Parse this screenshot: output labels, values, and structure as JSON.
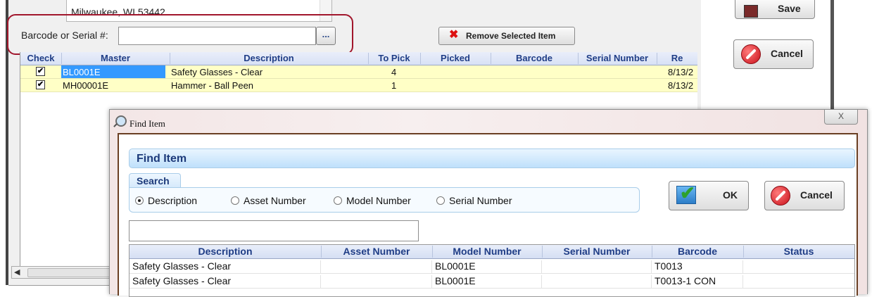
{
  "background": {
    "address_line": "Milwaukee, WI  53442",
    "barcode_label": "Barcode or Serial #:",
    "barcode_value": "",
    "browse_label": "...",
    "remove_button": "Remove Selected Item",
    "save_button": "Save",
    "cancel_button": "Cancel",
    "grid": {
      "columns": [
        "Check",
        "Master",
        "Description",
        "To Pick",
        "Picked",
        "Barcode",
        "Serial Number",
        "Re"
      ],
      "rows": [
        {
          "checked": true,
          "master": "BL0001E",
          "description": "Safety Glasses - Clear",
          "to_pick": "4",
          "picked": "",
          "barcode": "",
          "serial": "",
          "re": "8/13/2"
        },
        {
          "checked": true,
          "master": "MH00001E",
          "description": "Hammer - Ball Peen",
          "to_pick": "1",
          "picked": "",
          "barcode": "",
          "serial": "",
          "re": "8/13/2"
        }
      ]
    }
  },
  "dialog": {
    "title": "Find Item",
    "close_label": "X",
    "header": "Find Item",
    "search_tab": "Search",
    "search_options": [
      "Description",
      "Asset Number",
      "Model Number",
      "Serial Number"
    ],
    "selected_option": "Description",
    "search_value": "",
    "ok_button": "OK",
    "cancel_button": "Cancel",
    "results": {
      "columns": [
        "Description",
        "Asset Number",
        "Model Number",
        "Serial Number",
        "Barcode",
        "Status"
      ],
      "rows": [
        [
          "Safety Glasses - Clear",
          "",
          "BL0001E",
          "",
          "T0013",
          ""
        ],
        [
          "Safety Glasses - Clear",
          "",
          "BL0001E",
          "",
          "T0013-1 CON",
          ""
        ]
      ]
    }
  },
  "colors": {
    "highlight_ring": "#a1162c",
    "grid_header_text": "#1f3d86",
    "row_fill": "#ffffc6",
    "selected_cell": "#3399ff",
    "dialog_frame": "#6a3f23"
  }
}
